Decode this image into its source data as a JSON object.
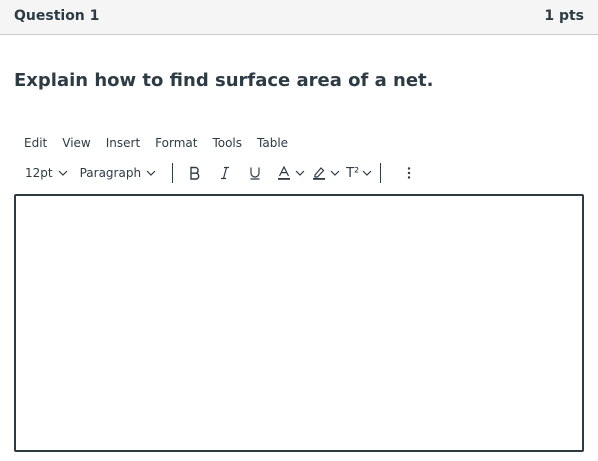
{
  "question": {
    "title": "Question 1",
    "points": "1 pts",
    "prompt": "Explain how to find surface area of a net."
  },
  "menubar": {
    "items": [
      "Edit",
      "View",
      "Insert",
      "Format",
      "Tools",
      "Table"
    ]
  },
  "toolbar": {
    "font_size": "12pt",
    "block_format": "Paragraph",
    "superscript_label": "T²",
    "icons": [
      "bold-icon",
      "italic-icon",
      "underline-icon",
      "text-color-icon",
      "highlight-color-icon",
      "superscript-icon",
      "more-vertical-icon"
    ]
  },
  "editor": {
    "value": ""
  },
  "colors": {
    "text": "#2d3b45",
    "header_bg": "#f5f5f5",
    "border": "#c7cdd1"
  }
}
